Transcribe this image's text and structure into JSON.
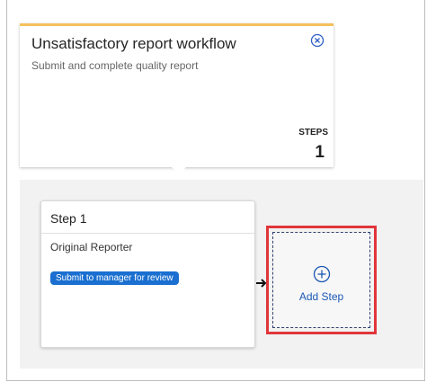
{
  "workflow": {
    "title": "Unsatisfactory report workflow",
    "subtitle": "Submit and complete quality report",
    "steps_label": "STEPS",
    "steps_count": "1",
    "accent_color": "#f5c15c"
  },
  "step": {
    "title": "Step 1",
    "role": "Original Reporter",
    "action_label": "Submit to manager for review",
    "action_color": "#1a6fd0"
  },
  "add_step": {
    "label": "Add Step",
    "highlight_color": "#e0363a"
  },
  "icons": {
    "close": "close-circle-icon",
    "arrow": "arrow-right-icon",
    "add": "plus-circle-icon"
  }
}
